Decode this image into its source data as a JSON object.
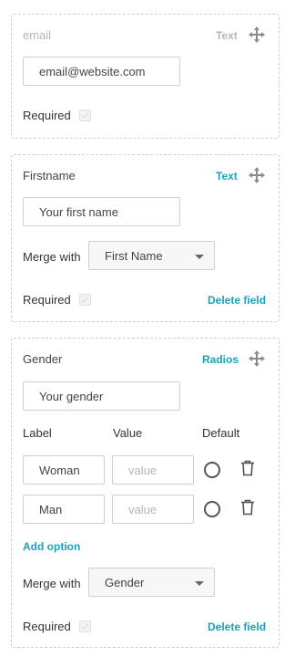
{
  "fields": {
    "email": {
      "title": "email",
      "type": "Text",
      "placeholder": "email@website.com",
      "required_label": "Required"
    },
    "firstname": {
      "title": "Firstname",
      "type": "Text",
      "placeholder": "Your first name",
      "merge_label": "Merge with",
      "merge_value": "First Name",
      "required_label": "Required",
      "delete_label": "Delete field"
    },
    "gender": {
      "title": "Gender",
      "type": "Radios",
      "placeholder": "Your gender",
      "options_header": {
        "label": "Label",
        "value": "Value",
        "default": "Default"
      },
      "options": [
        {
          "label": "Woman",
          "value_placeholder": "value"
        },
        {
          "label": "Man",
          "value_placeholder": "value"
        }
      ],
      "add_option_label": "Add option",
      "merge_label": "Merge with",
      "merge_value": "Gender",
      "required_label": "Required",
      "delete_label": "Delete field"
    }
  },
  "icons": {
    "move": "move-arrows-icon",
    "trash": "trash-icon",
    "radio": "radio-empty-icon"
  },
  "colors": {
    "accent": "#1aa3bd",
    "muted": "#b5b5b5",
    "border": "#cfcfcf"
  }
}
